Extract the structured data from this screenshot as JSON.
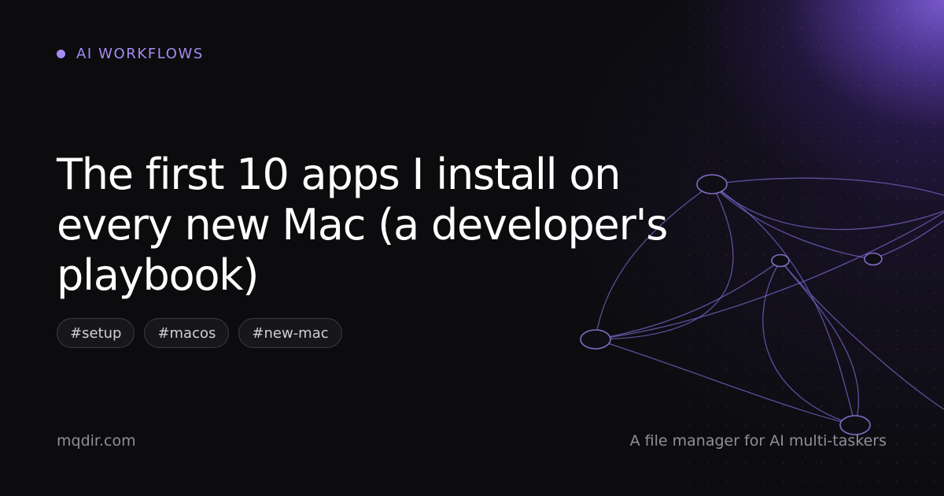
{
  "category": {
    "label": "AI WORKFLOWS"
  },
  "title": "The first 10 apps I install on every new Mac (a developer's playbook)",
  "tags": [
    "#setup",
    "#macos",
    "#new-mac"
  ],
  "footer": {
    "domain": "mqdir.com",
    "tagline": "A file manager for AI multi-taskers"
  },
  "colors": {
    "background": "#0c0c0e",
    "accent": "#a58cf3",
    "glow": "#7e5cd6",
    "text": "#ffffff",
    "muted": "#8f8f98"
  }
}
